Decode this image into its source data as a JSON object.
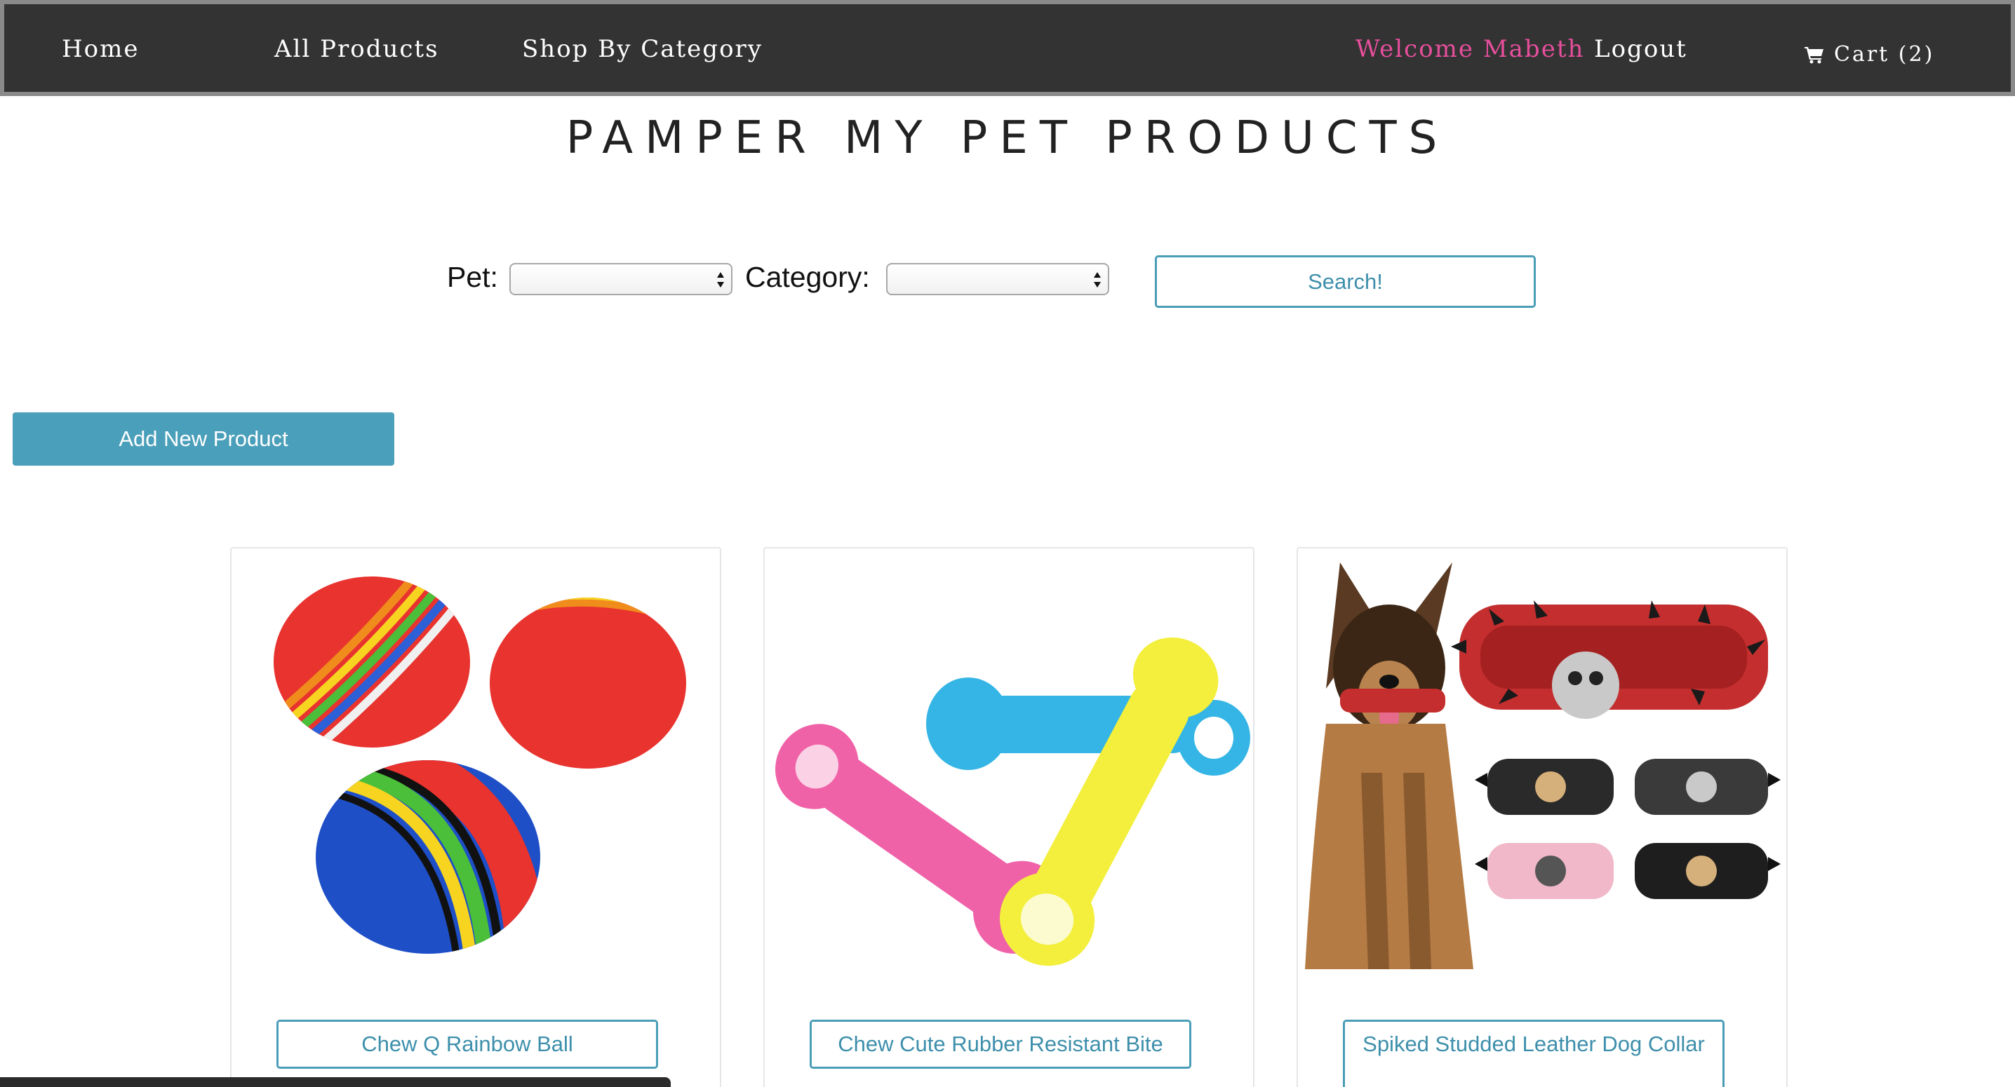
{
  "nav": {
    "home": "Home",
    "all_products": "All Products",
    "shop_by_category": "Shop By Category",
    "welcome": "Welcome Mabeth",
    "logout": "Logout",
    "cart": "Cart (2)",
    "cart_icon": "shopping-cart-icon",
    "welcome_color": "#e64f9c",
    "bar_color": "#333333"
  },
  "title": "PAMPER MY PET PRODUCTS",
  "search_form": {
    "pet_label": "Pet:",
    "pet_value": "",
    "category_label": "Category:",
    "category_value": "",
    "search_button": "Search!"
  },
  "add_product_button": "Add New Product",
  "accent_color": "#4a9fba",
  "products": [
    {
      "name": "Chew Q Rainbow Ball",
      "image": "rainbow-balls-image"
    },
    {
      "name": "Chew Cute Rubber Resistant Bite",
      "image": "rubber-bone-toys-image"
    },
    {
      "name": "Spiked Studded Leather Dog Collar",
      "image": "dog-spiked-collars-image"
    }
  ]
}
